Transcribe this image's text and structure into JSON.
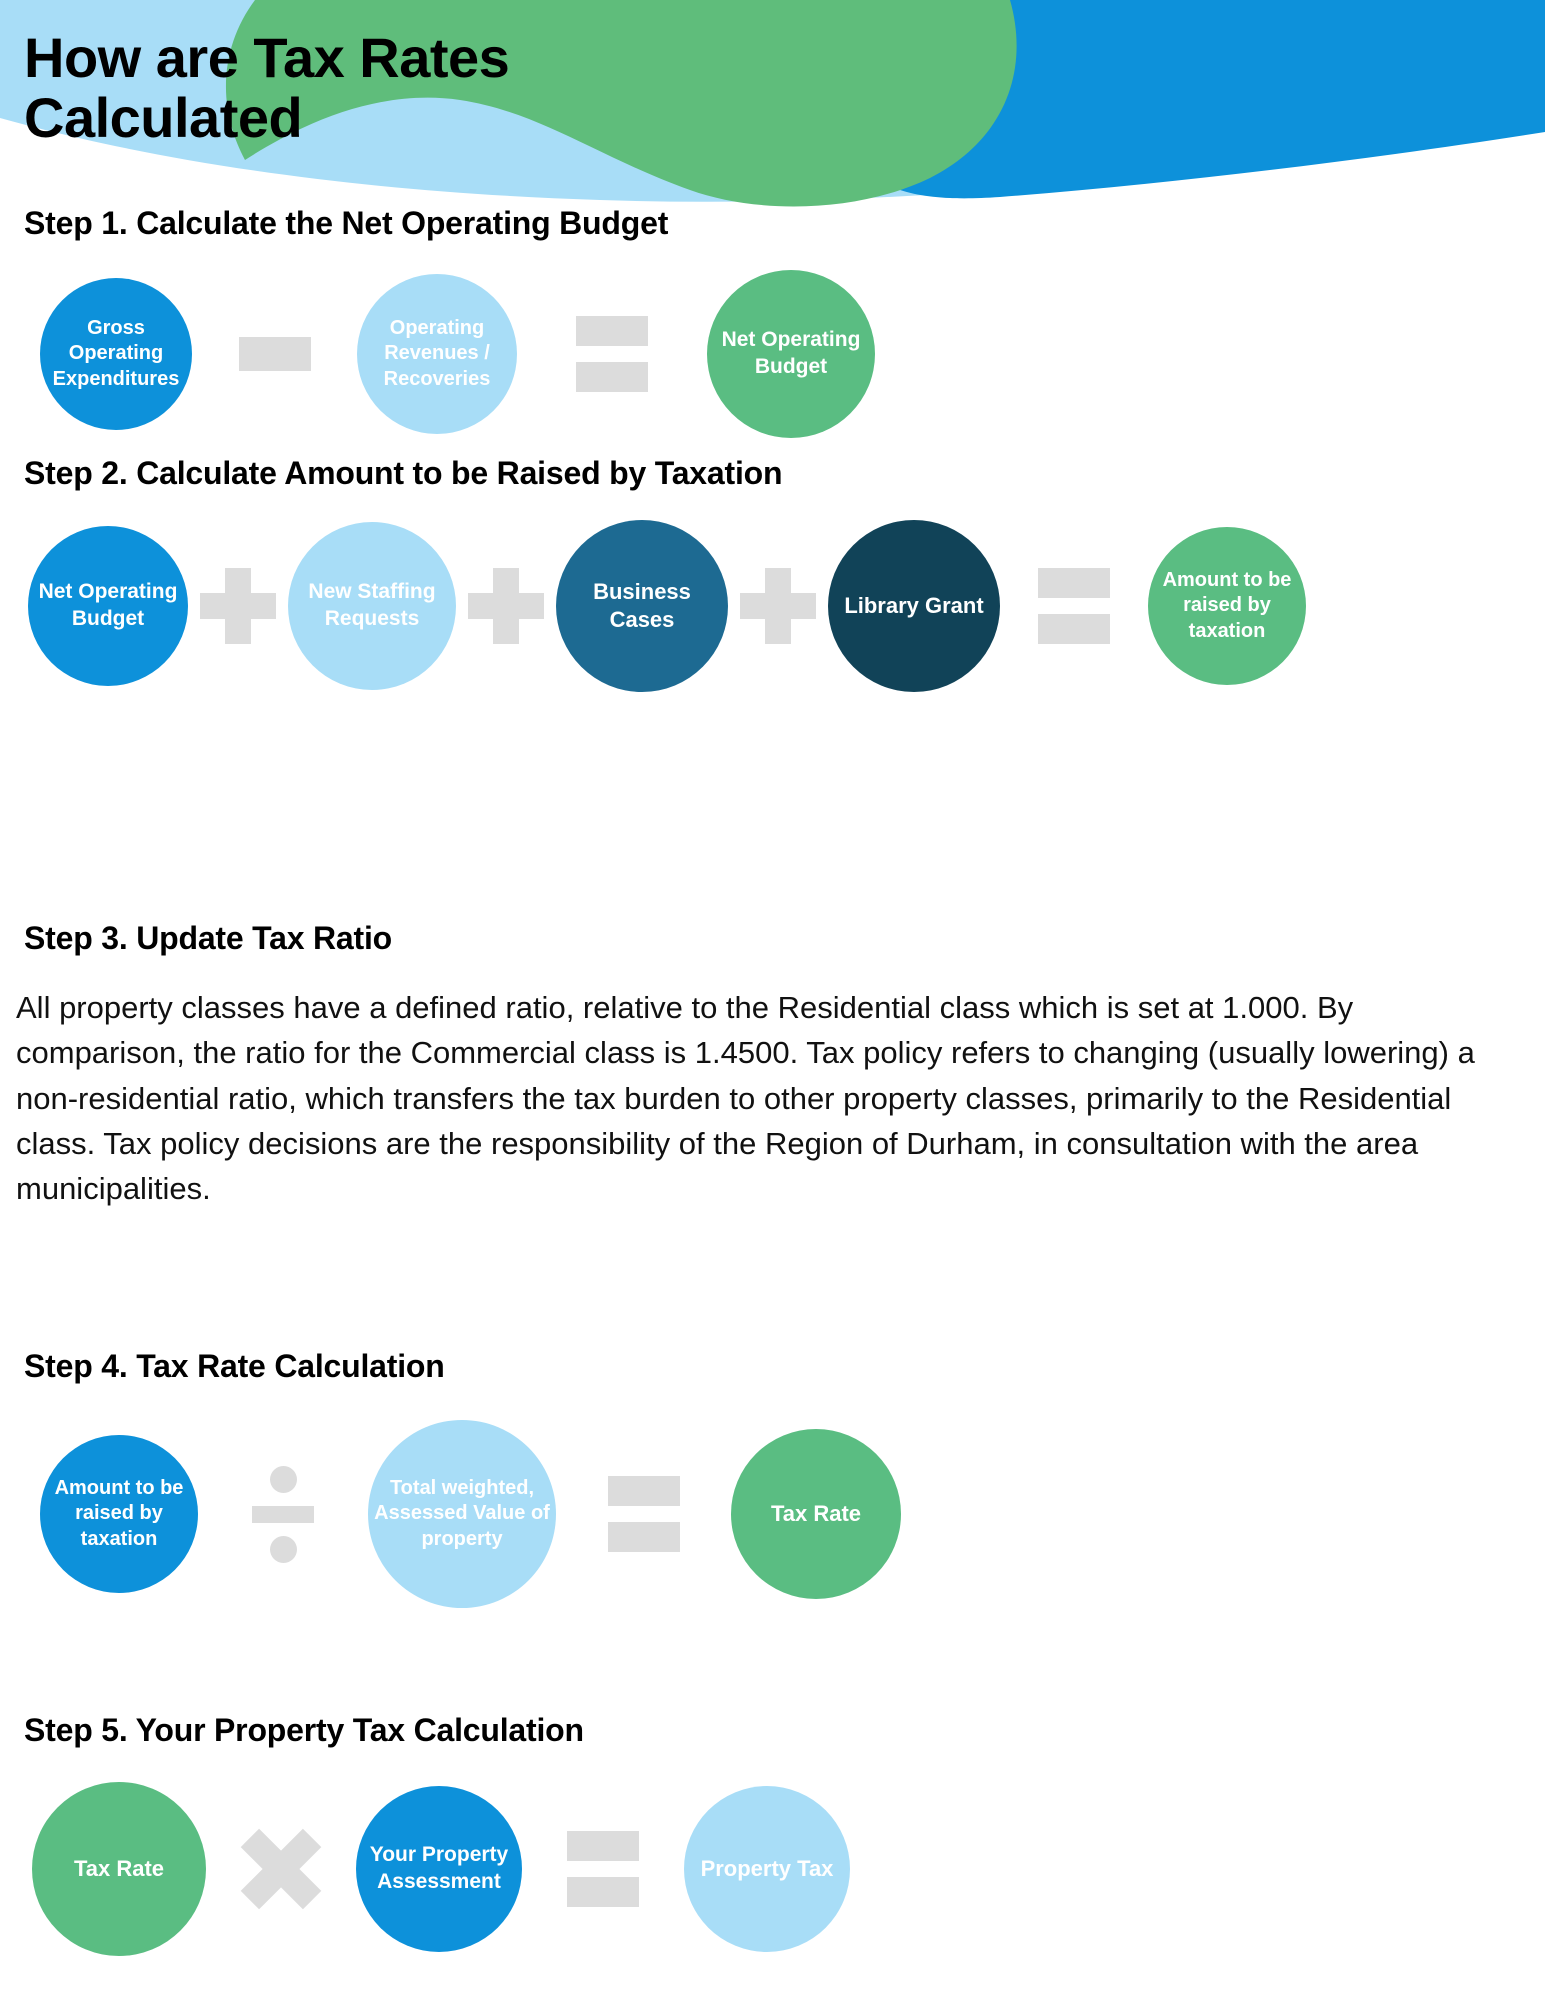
{
  "title": "How are Tax Rates\nCalculated",
  "colors": {
    "blue": "#0d91da",
    "light_blue": "#a8ddf7",
    "green": "#5abd82",
    "teal_dark": "#1d6a92",
    "navy": "#114358",
    "grey_operator": "#dcdcdc",
    "header_light_blue": "#a8ddf7",
    "header_green": "#5fbd7b",
    "header_blue": "#0d91da"
  },
  "steps": [
    {
      "id": "step-1",
      "heading": "Step 1. Calculate the Net Operating Budget",
      "nodes": [
        {
          "label": "Gross Operating Expenditures",
          "color_key": "blue"
        },
        {
          "label": "Operating Revenues / Recoveries",
          "color_key": "light_blue"
        },
        {
          "label": "Net Operating Budget",
          "color_key": "green"
        }
      ],
      "operators": [
        "minus",
        "equals"
      ]
    },
    {
      "id": "step-2",
      "heading": "Step 2. Calculate Amount to be Raised by Taxation",
      "nodes": [
        {
          "label": "Net Operating Budget",
          "color_key": "blue"
        },
        {
          "label": "New Staffing Requests",
          "color_key": "light_blue"
        },
        {
          "label": "Business Cases",
          "color_key": "teal_dark"
        },
        {
          "label": "Library Grant",
          "color_key": "navy"
        },
        {
          "label": "Amount to be raised by taxation",
          "color_key": "green"
        }
      ],
      "operators": [
        "plus",
        "plus",
        "plus",
        "equals"
      ]
    },
    {
      "id": "step-3",
      "heading": "Step 3. Update Tax Ratio",
      "paragraph": "All property classes have a defined ratio, relative to the Residential class which is set at 1.000. By comparison, the ratio for the Commercial class is 1.4500. Tax policy refers to changing (usually lowering) a non-residential ratio, which transfers the tax burden to other property classes, primarily to the Residential class. Tax policy decisions are the responsibility of the Region of Durham, in consultation with the area municipalities."
    },
    {
      "id": "step-4",
      "heading": "Step 4. Tax Rate Calculation",
      "nodes": [
        {
          "label": "Amount to be raised by taxation",
          "color_key": "blue"
        },
        {
          "label": "Total weighted, Assessed Value of property",
          "color_key": "light_blue"
        },
        {
          "label": "Tax Rate",
          "color_key": "green"
        }
      ],
      "operators": [
        "divide",
        "equals"
      ]
    },
    {
      "id": "step-5",
      "heading": "Step 5. Your Property Tax Calculation",
      "nodes": [
        {
          "label": "Tax Rate",
          "color_key": "green"
        },
        {
          "label": "Your Property Assessment",
          "color_key": "blue"
        },
        {
          "label": "Property Tax",
          "color_key": "light_blue"
        }
      ],
      "operators": [
        "times",
        "equals"
      ]
    }
  ]
}
